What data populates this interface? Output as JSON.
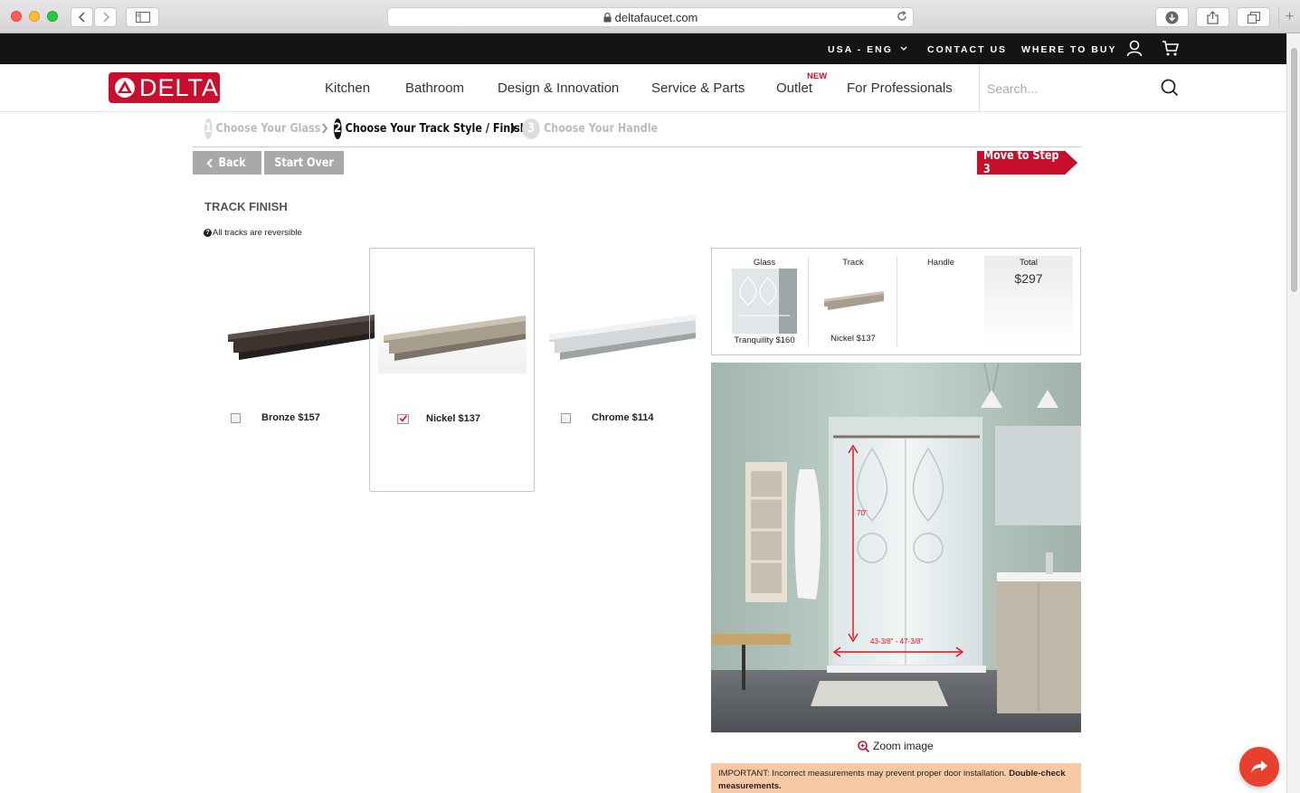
{
  "browser": {
    "url": "deltafaucet.com"
  },
  "utility": {
    "locale": "USA - ENG",
    "contact": "CONTACT US",
    "where_to_buy": "WHERE TO BUY"
  },
  "brand": {
    "logo_text": "DELTA",
    "red": "#c8102e"
  },
  "nav": {
    "items": [
      "Kitchen",
      "Bathroom",
      "Design & Innovation",
      "Service & Parts",
      "Outlet",
      "For Professionals"
    ],
    "new_badge": "NEW",
    "search_placeholder": "Search..."
  },
  "steps": [
    {
      "num": "1",
      "label": "Choose Your Glass",
      "state": "done"
    },
    {
      "num": "2",
      "label": "Choose Your Track Style / Finish",
      "state": "active"
    },
    {
      "num": "3",
      "label": "Choose Your Handle",
      "state": "todo"
    }
  ],
  "actions": {
    "back": "Back",
    "start_over": "Start Over",
    "next": "Move to Step 3"
  },
  "section": {
    "title": "TRACK FINISH",
    "note": "All tracks are reversible"
  },
  "options": [
    {
      "label": "Bronze $157",
      "selected": false,
      "color": "#3d3430"
    },
    {
      "label": "Nickel $137",
      "selected": true,
      "color": "#a89e8e"
    },
    {
      "label": "Chrome $114",
      "selected": false,
      "color": "#d5d8da"
    }
  ],
  "summary": {
    "glass_head": "Glass",
    "glass_caption": "Tranquility $160",
    "track_head": "Track",
    "track_caption": "Nickel $137",
    "handle_head": "Handle",
    "total_head": "Total",
    "total_value": "$297"
  },
  "preview": {
    "height_label": "70\"",
    "width_label": "43-3/8\" - 47-3/8\"",
    "zoom_label": "Zoom image"
  },
  "warning": {
    "text": "IMPORTANT: Incorrect measurements may prevent proper door installation. ",
    "bold": "Double-check measurements."
  }
}
